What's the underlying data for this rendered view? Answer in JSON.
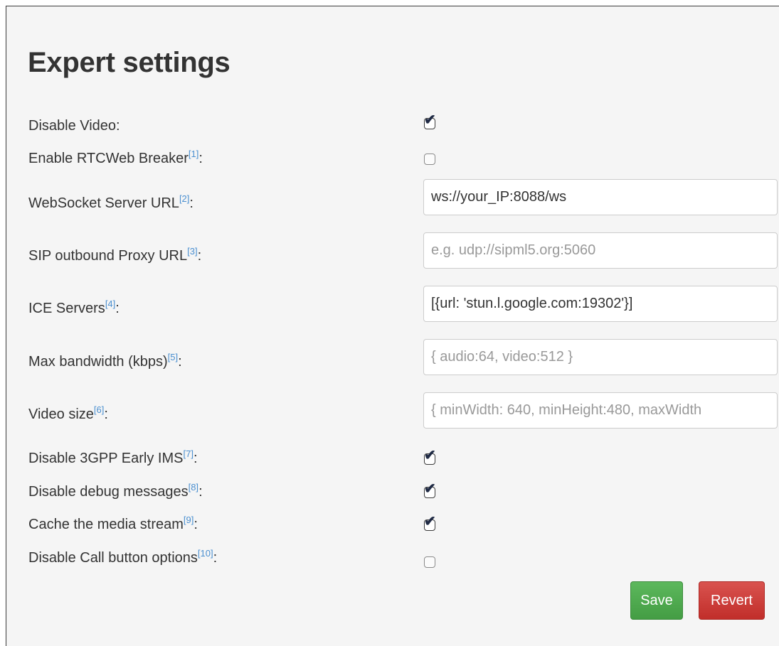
{
  "title": "Expert settings",
  "colors": {
    "save_button": "#5cb85c",
    "revert_button": "#d9534f",
    "footnote_link": "#4a8fd0",
    "panel_background": "#f5f5f5"
  },
  "settings": {
    "disable_video": {
      "label": "Disable Video:",
      "note": "",
      "suffix": "",
      "checked": true
    },
    "rtcweb_breaker": {
      "label": "Enable RTCWeb Breaker",
      "note": "[1]",
      "suffix": ":",
      "checked": false
    },
    "websocket_url": {
      "label": "WebSocket Server URL",
      "note": "[2]",
      "suffix": ":",
      "value": "ws://your_IP:8088/ws",
      "placeholder": ""
    },
    "sip_proxy_url": {
      "label": "SIP outbound Proxy URL",
      "note": "[3]",
      "suffix": ":",
      "value": "",
      "placeholder": "e.g. udp://sipml5.org:5060"
    },
    "ice_servers": {
      "label": "ICE Servers",
      "note": "[4]",
      "suffix": ":",
      "value": "[{url: 'stun.l.google.com:19302'}]",
      "placeholder": ""
    },
    "max_bandwidth": {
      "label": "Max bandwidth (kbps)",
      "note": "[5]",
      "suffix": ":",
      "value": "",
      "placeholder": "{ audio:64, video:512 }"
    },
    "video_size": {
      "label": "Video size",
      "note": "[6]",
      "suffix": ":",
      "value": "",
      "placeholder": "{ minWidth: 640, minHeight:480, maxWidth"
    },
    "disable_early_ims": {
      "label": "Disable 3GPP Early IMS",
      "note": "[7]",
      "suffix": ":",
      "checked": true
    },
    "disable_debug": {
      "label": "Disable debug messages",
      "note": "[8]",
      "suffix": ":",
      "checked": true
    },
    "cache_media": {
      "label": "Cache the media stream",
      "note": "[9]",
      "suffix": ":",
      "checked": true
    },
    "disable_call_options": {
      "label": "Disable Call button options",
      "note": "[10]",
      "suffix": ":",
      "checked": false
    }
  },
  "buttons": {
    "save": "Save",
    "revert": "Revert"
  }
}
